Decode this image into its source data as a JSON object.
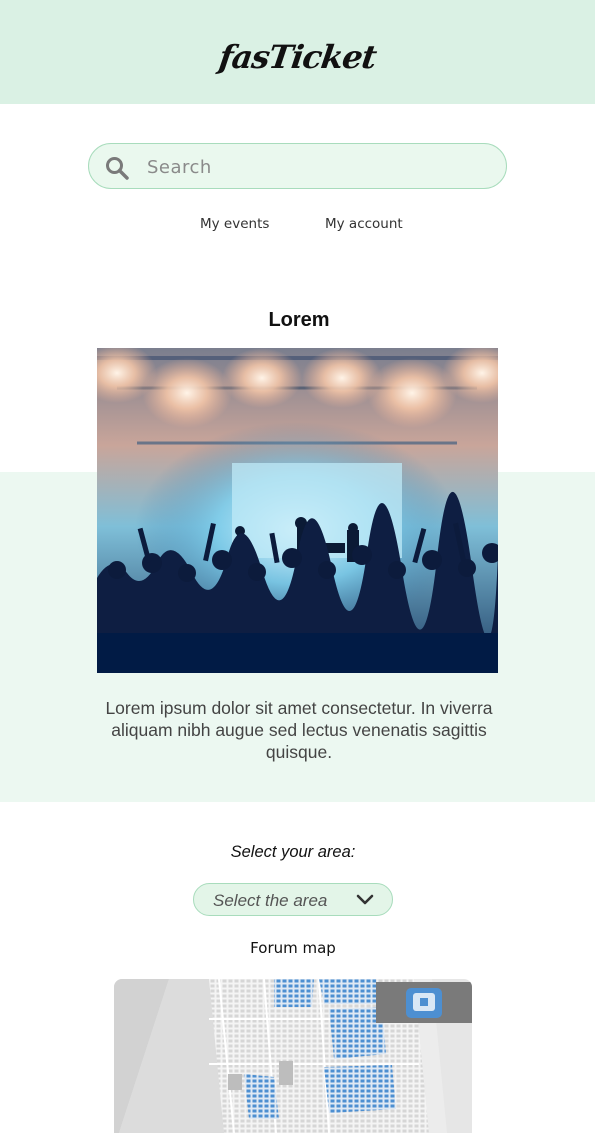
{
  "header": {
    "logo_text": "fasTicket"
  },
  "search": {
    "placeholder": "Search",
    "value": ""
  },
  "nav": {
    "my_events": "My events",
    "my_account": "My account"
  },
  "event": {
    "title": "Lorem",
    "description": "Lorem ipsum dolor sit amet consectetur. In viverra aliquam nibh augue sed lectus venenatis sagittis quisque."
  },
  "area": {
    "label": "Select your area:",
    "selected": "Select the area"
  },
  "map": {
    "title": "Forum map"
  },
  "colors": {
    "header_bg": "#daf1e4",
    "band_bg": "#ecf8f1",
    "input_bg": "#eaf8ee",
    "input_border": "#a8dcbc"
  },
  "icons": {
    "search": "search-icon",
    "dropdown": "chevron-down-icon"
  }
}
